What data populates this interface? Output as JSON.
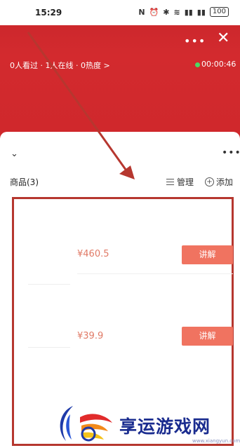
{
  "status_bar": {
    "time": "15:29",
    "battery": "100"
  },
  "header": {
    "viewers_text": "0人看过 · 1人在线 · 0热度 >",
    "live_duration": "00:00:46",
    "more_icon": "ellipsis-icon",
    "close_icon": "close-icon"
  },
  "sheet": {
    "goods_title": "商品(3)",
    "manage_label": "管理",
    "add_label": "添加"
  },
  "products": [
    {
      "price": "¥460.5",
      "action_label": "讲解"
    },
    {
      "price": "¥39.9",
      "action_label": "讲解"
    }
  ],
  "colors": {
    "header_red": "#d32a2e",
    "price": "#e07a66",
    "button": "#f07360",
    "highlight": "#b6372f"
  },
  "watermark": {
    "text": "享运游戏网",
    "small": "www.xiangyun.com"
  }
}
